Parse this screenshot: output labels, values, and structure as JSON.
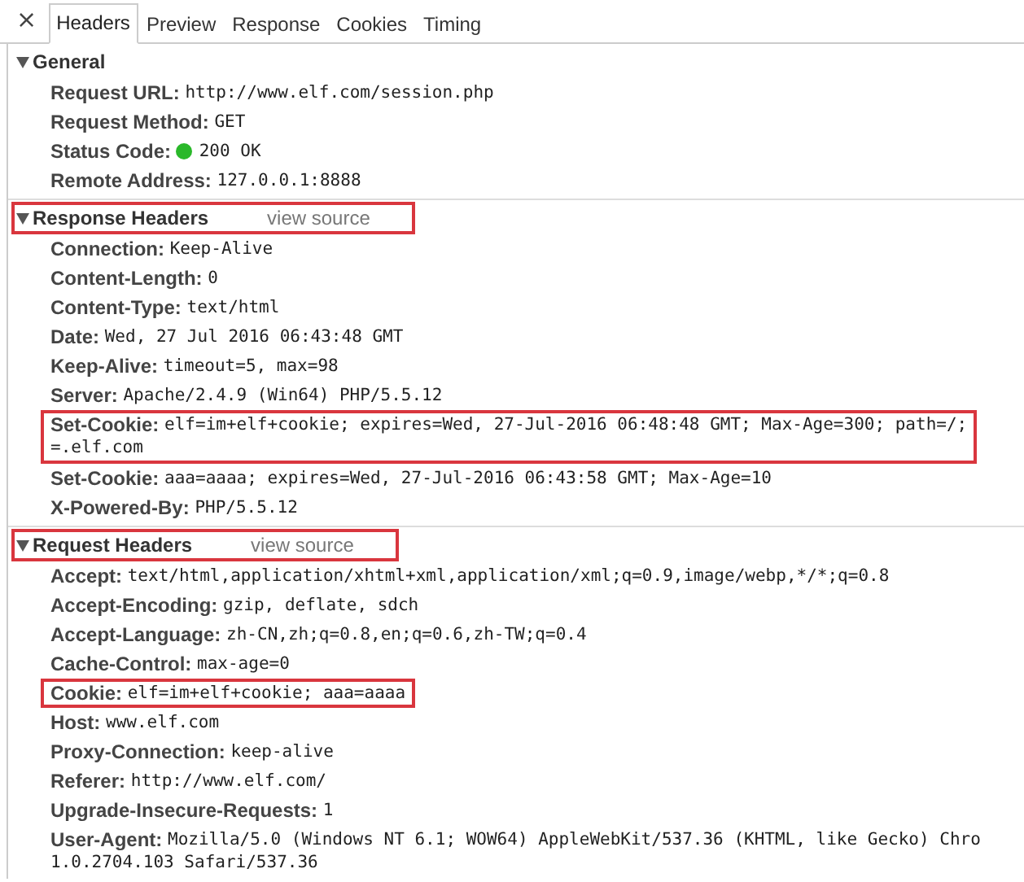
{
  "close_button": "×",
  "tabs": [
    {
      "label": "Headers",
      "selected": true
    },
    {
      "label": "Preview",
      "selected": false
    },
    {
      "label": "Response",
      "selected": false
    },
    {
      "label": "Cookies",
      "selected": false
    },
    {
      "label": "Timing",
      "selected": false
    }
  ],
  "sections": [
    {
      "title": "General",
      "expanded": true,
      "highlighted": false,
      "rows": [
        {
          "kind": "plain",
          "name": "Request URL:",
          "value": [
            "http://www.elf.com/session.php"
          ],
          "highlighted": false
        },
        {
          "kind": "plain",
          "name": "Request Method:",
          "value": [
            "GET"
          ],
          "highlighted": false
        },
        {
          "kind": "status",
          "name": "Status Code:",
          "value": [
            "200 OK"
          ],
          "highlighted": false
        },
        {
          "kind": "plain",
          "name": "Remote Address:",
          "value": [
            "127.0.0.1:8888"
          ],
          "highlighted": false
        }
      ]
    },
    {
      "title": "Response Headers",
      "link": "view source",
      "expanded": true,
      "highlighted": true,
      "rows": [
        {
          "kind": "plain",
          "name": "Connection:",
          "value": [
            "Keep-Alive"
          ],
          "highlighted": false
        },
        {
          "kind": "plain",
          "name": "Content-Length:",
          "value": [
            "0"
          ],
          "highlighted": false
        },
        {
          "kind": "plain",
          "name": "Content-Type:",
          "value": [
            "text/html"
          ],
          "highlighted": false
        },
        {
          "kind": "plain",
          "name": "Date:",
          "value": [
            "Wed, 27 Jul 2016 06:43:48 GMT"
          ],
          "highlighted": false
        },
        {
          "kind": "plain",
          "name": "Keep-Alive:",
          "value": [
            "timeout=5, max=98"
          ],
          "highlighted": false
        },
        {
          "kind": "plain",
          "name": "Server:",
          "value": [
            "Apache/2.4.9 (Win64) PHP/5.5.12"
          ],
          "highlighted": false
        },
        {
          "kind": "plain",
          "name": "Set-Cookie:",
          "value": [
            "elf=im+elf+cookie; expires=Wed, 27-Jul-2016 06:48:48 GMT; Max-Age=300; path=/;",
            "=.elf.com"
          ],
          "highlighted": true
        },
        {
          "kind": "plain",
          "name": "Set-Cookie:",
          "value": [
            "aaa=aaaa; expires=Wed, 27-Jul-2016 06:43:58 GMT; Max-Age=10"
          ],
          "highlighted": false
        },
        {
          "kind": "plain",
          "name": "X-Powered-By:",
          "value": [
            "PHP/5.5.12"
          ],
          "highlighted": false
        }
      ]
    },
    {
      "title": "Request Headers",
      "link": "view source",
      "expanded": true,
      "highlighted": true,
      "rows": [
        {
          "kind": "plain",
          "name": "Accept:",
          "value": [
            "text/html,application/xhtml+xml,application/xml;q=0.9,image/webp,*/*;q=0.8"
          ],
          "highlighted": false
        },
        {
          "kind": "plain",
          "name": "Accept-Encoding:",
          "value": [
            "gzip, deflate, sdch"
          ],
          "highlighted": false
        },
        {
          "kind": "plain",
          "name": "Accept-Language:",
          "value": [
            "zh-CN,zh;q=0.8,en;q=0.6,zh-TW;q=0.4"
          ],
          "highlighted": false
        },
        {
          "kind": "plain",
          "name": "Cache-Control:",
          "value": [
            "max-age=0"
          ],
          "highlighted": false
        },
        {
          "kind": "plain",
          "name": "Cookie:",
          "value": [
            "elf=im+elf+cookie; aaa=aaaa"
          ],
          "highlighted": true
        },
        {
          "kind": "plain",
          "name": "Host:",
          "value": [
            "www.elf.com"
          ],
          "highlighted": false
        },
        {
          "kind": "plain",
          "name": "Proxy-Connection:",
          "value": [
            "keep-alive"
          ],
          "highlighted": false
        },
        {
          "kind": "plain",
          "name": "Referer:",
          "value": [
            "http://www.elf.com/"
          ],
          "highlighted": false
        },
        {
          "kind": "plain",
          "name": "Upgrade-Insecure-Requests:",
          "value": [
            "1"
          ],
          "highlighted": false
        },
        {
          "kind": "plain",
          "name": "User-Agent:",
          "value": [
            "Mozilla/5.0 (Windows NT 6.1; WOW64) AppleWebKit/537.36 (KHTML, like Gecko) Chro",
            "1.0.2704.103 Safari/537.36"
          ],
          "highlighted": false
        }
      ]
    }
  ]
}
